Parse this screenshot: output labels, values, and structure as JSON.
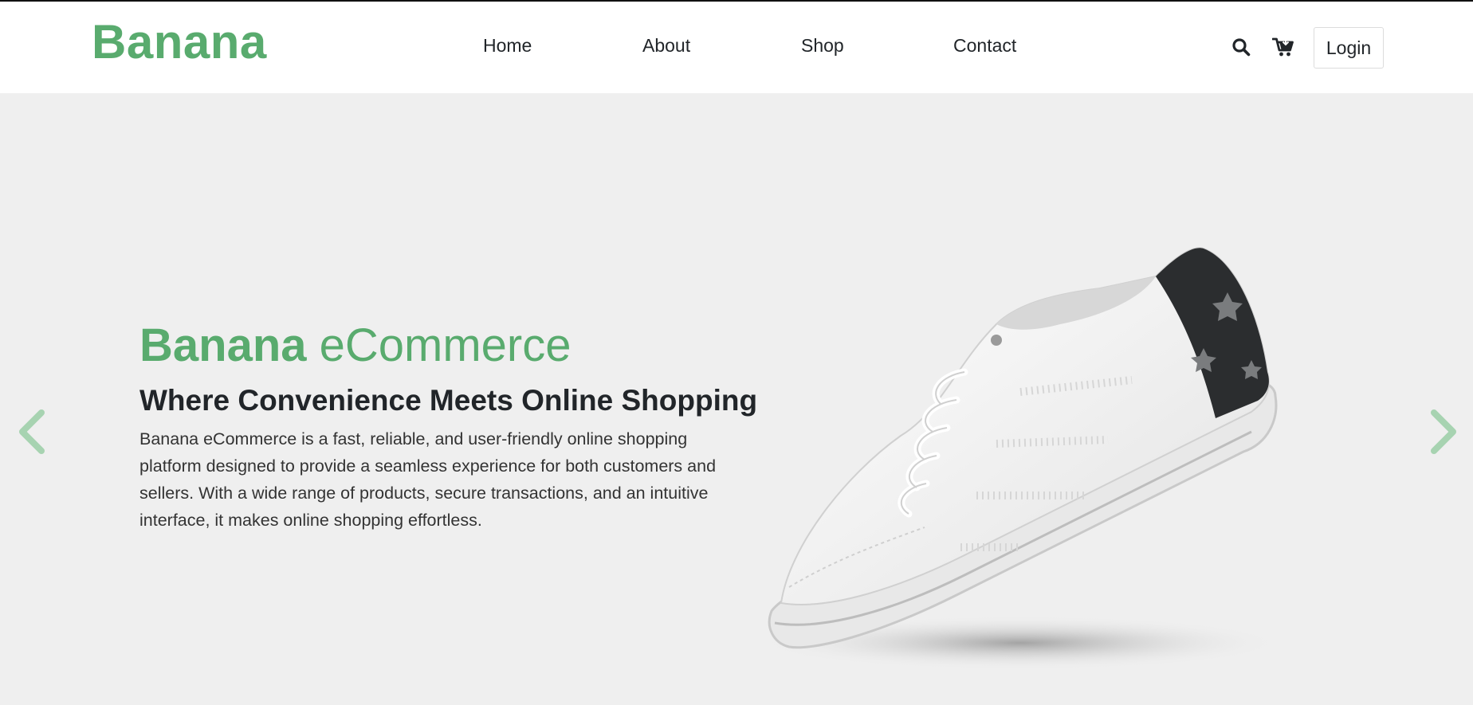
{
  "brand": {
    "name": "Banana",
    "color": "#59ab6e"
  },
  "nav": {
    "items": [
      {
        "label": "Home"
      },
      {
        "label": "About"
      },
      {
        "label": "Shop"
      },
      {
        "label": "Contact"
      }
    ]
  },
  "header_actions": {
    "search_icon": "search-icon",
    "cart_icon": "cart-icon",
    "login_label": "Login"
  },
  "hero": {
    "title_strong": "Banana",
    "title_light": "eCommerce",
    "subtitle": "Where Convenience Meets Online Shopping",
    "description": "Banana eCommerce is a fast, reliable, and user-friendly online shopping platform designed to provide a seamless experience for both customers and sellers. With a wide range of products, secure transactions, and an intuitive interface, it makes online shopping effortless.",
    "image": "white-sneaker-with-dark-heel",
    "prev_icon": "chevron-left-icon",
    "next_icon": "chevron-right-icon",
    "background": "#efefef"
  }
}
